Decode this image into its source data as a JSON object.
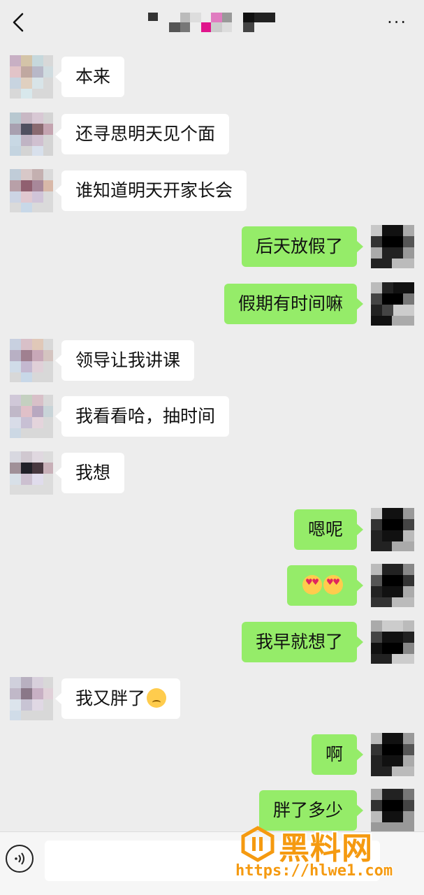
{
  "header": {
    "back_icon": "chevron-left-icon",
    "title_obscured": true,
    "more_label": "···",
    "colors": {
      "background": "#ededed"
    }
  },
  "messages": [
    {
      "side": "left",
      "text": "本来"
    },
    {
      "side": "left",
      "text": "还寻思明天见个面"
    },
    {
      "side": "left",
      "text": "谁知道明天开家长会"
    },
    {
      "side": "right",
      "text": "后天放假了"
    },
    {
      "side": "right",
      "text": "假期有时间嘛"
    },
    {
      "side": "left",
      "text": "领导让我讲课"
    },
    {
      "side": "left",
      "text": "我看看哈，抽时间"
    },
    {
      "side": "left",
      "text": "我想"
    },
    {
      "side": "right",
      "text": "嗯呢"
    },
    {
      "side": "right",
      "text": "",
      "emoji": [
        "heart-eyes-emoji",
        "heart-eyes-emoji"
      ]
    },
    {
      "side": "right",
      "text": "我早就想了"
    },
    {
      "side": "left",
      "text": "我又胖了",
      "emoji": [
        "sad-face-emoji"
      ]
    },
    {
      "side": "right",
      "text": "啊"
    },
    {
      "side": "right",
      "text": "胖了多少"
    }
  ],
  "bubble_colors": {
    "sent": "#95ec69",
    "received": "#ffffff"
  },
  "input_bar": {
    "voice_icon": "voice-input-icon",
    "placeholder": ""
  },
  "watermark": {
    "text": "黑料网",
    "url": "https://hlwe1.com",
    "color": "#f59a10"
  }
}
